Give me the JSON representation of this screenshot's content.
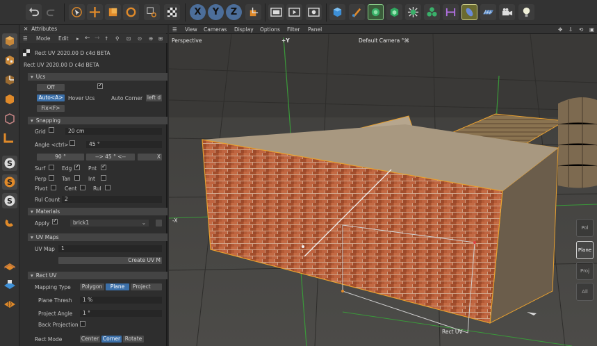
{
  "toolbar": {
    "icons": [
      "undo-icon",
      "redo-icon",
      "select-icon",
      "move-icon",
      "scale-icon",
      "rotate-icon",
      "recent-icon",
      "checker-icon",
      "x-axis-icon",
      "y-axis-icon",
      "z-axis-icon",
      "coordinate-system-icon",
      "render-region-icon",
      "render-view-icon",
      "render-settings-icon",
      "cube-icon",
      "pen-icon",
      "subdivision-icon",
      "generator-icon",
      "mograph-icon",
      "cloner-icon",
      "deformer-icon",
      "tag-icon",
      "floor-icon",
      "camera-icon",
      "light-icon"
    ],
    "axis_labels": {
      "x": "X",
      "y": "Y",
      "z": "Z"
    }
  },
  "attributes": {
    "title": "Attributes",
    "menu": {
      "mode": "Mode",
      "edit": "Edit"
    },
    "object_name": "Rect UV 2020.00 D c4d BETA",
    "object_name2": "Rect UV 2020.00 D c4d BETA",
    "ucs": {
      "header": "Ucs",
      "off": "Off",
      "auto": "Auto<A>",
      "fix": "Fix<F>",
      "hover_ucs": "Hover Ucs",
      "auto_corner": "Auto Corner",
      "auto_corner_value": "left d"
    },
    "snapping": {
      "header": "Snapping",
      "grid": "Grid",
      "grid_value": "20 cm",
      "angle": "Angle <ctrl>",
      "angle_value": "45 °",
      "btn_90": "90 °",
      "btn_45": "--> 45 ° <--",
      "btn_x": "X",
      "surf": "Surf",
      "edg": "Edg",
      "pnt": "Pnt",
      "perp": "Perp",
      "tan": "Tan",
      "int": "Int",
      "pivot": "Pivot",
      "cent": "Cent",
      "rul": "Rul",
      "rul_count": "Rul Count",
      "rul_count_value": "2"
    },
    "materials": {
      "header": "Materials",
      "apply": "Apply",
      "material": "brick1"
    },
    "uv_maps": {
      "header": "UV Maps",
      "uv_map": "UV Map",
      "uv_map_value": "1",
      "create": "Create UV M"
    },
    "rect_uv": {
      "header": "Rect UV",
      "mapping_type": "Mapping Type",
      "polygon": "Polygon",
      "plane": "Plane",
      "project": "Project",
      "plane_thresh": "Plane Thresh",
      "plane_thresh_value": "1 %",
      "project_angle": "Project Angle",
      "project_angle_value": "1 °",
      "back_projection": "Back Projection",
      "rect_mode": "Rect Mode",
      "center": "Center",
      "corner": "Corner",
      "rotate": "Rotate"
    }
  },
  "viewport": {
    "menu": [
      "View",
      "Cameras",
      "Display",
      "Options",
      "Filter",
      "Panel"
    ],
    "perspective": "Perspective",
    "axis_y": "+Y",
    "axis_x": "-X",
    "camera": "Default Camera",
    "camera_mark": "°⌘",
    "bottom_label": "Rect UV",
    "modes": [
      "Pol",
      "Plane",
      "Proj",
      "All"
    ],
    "selected_mode": "Plane"
  },
  "colors": {
    "accent": "#3b6fa8",
    "brick": "#b4532e",
    "highlight": "#e8a030"
  }
}
